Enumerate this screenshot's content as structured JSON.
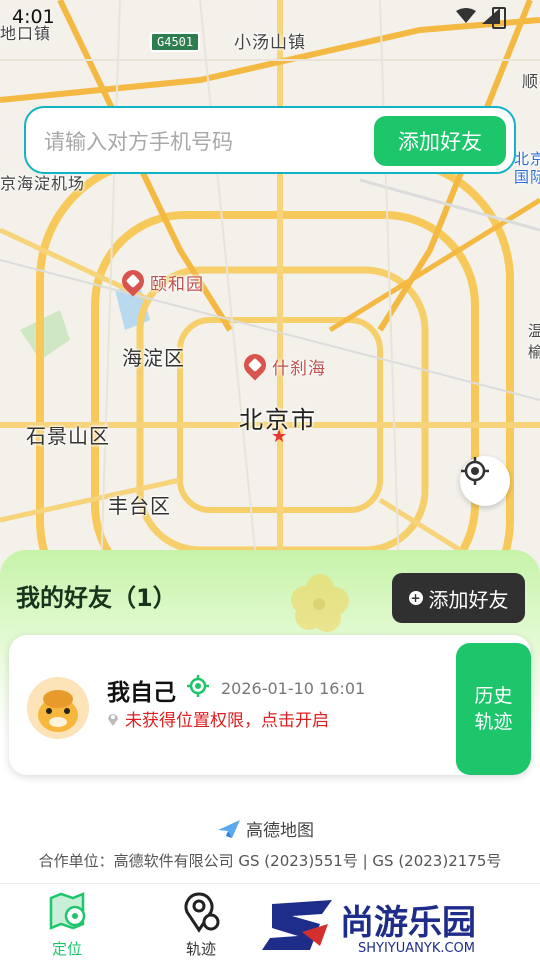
{
  "status_bar": {
    "time": "4:01"
  },
  "search": {
    "placeholder": "请输入对方手机号码",
    "add_label": "添加好友"
  },
  "map": {
    "labels": {
      "town1": "地口镇",
      "town2": "小汤山镇",
      "airport": "京海淀机场",
      "yiheyuan": "颐和园",
      "haidian": "海淀区",
      "shichahai": "什刹海",
      "beijing": "北京市",
      "shijingshan": "石景山区",
      "fengtai": "丰台区",
      "east_top": "顺",
      "east_beijing": "北京",
      "east_intl": "国际",
      "east_side": "温榆"
    },
    "highway": "G4501"
  },
  "friends_panel": {
    "title": "我的好友（1）",
    "add_label": "添加好友",
    "friends": [
      {
        "name": "我自己",
        "timestamp": "2026-01-10 16:01",
        "warning": "未获得位置权限，点击开启",
        "history_line1": "历史",
        "history_line2": "轨迹"
      }
    ]
  },
  "footer": {
    "amap": "高德地图",
    "partners": "合作单位：高德软件有限公司 GS (2023)551号 | GS (2023)2175号"
  },
  "nav": {
    "locate": "定位",
    "track": "轨迹"
  },
  "watermark": {
    "text": "尚游乐园",
    "url": "SHYIYUANYK.COM"
  },
  "colors": {
    "accent": "#1dc56b",
    "search_border": "#12b3c4",
    "warning": "#e02020"
  }
}
